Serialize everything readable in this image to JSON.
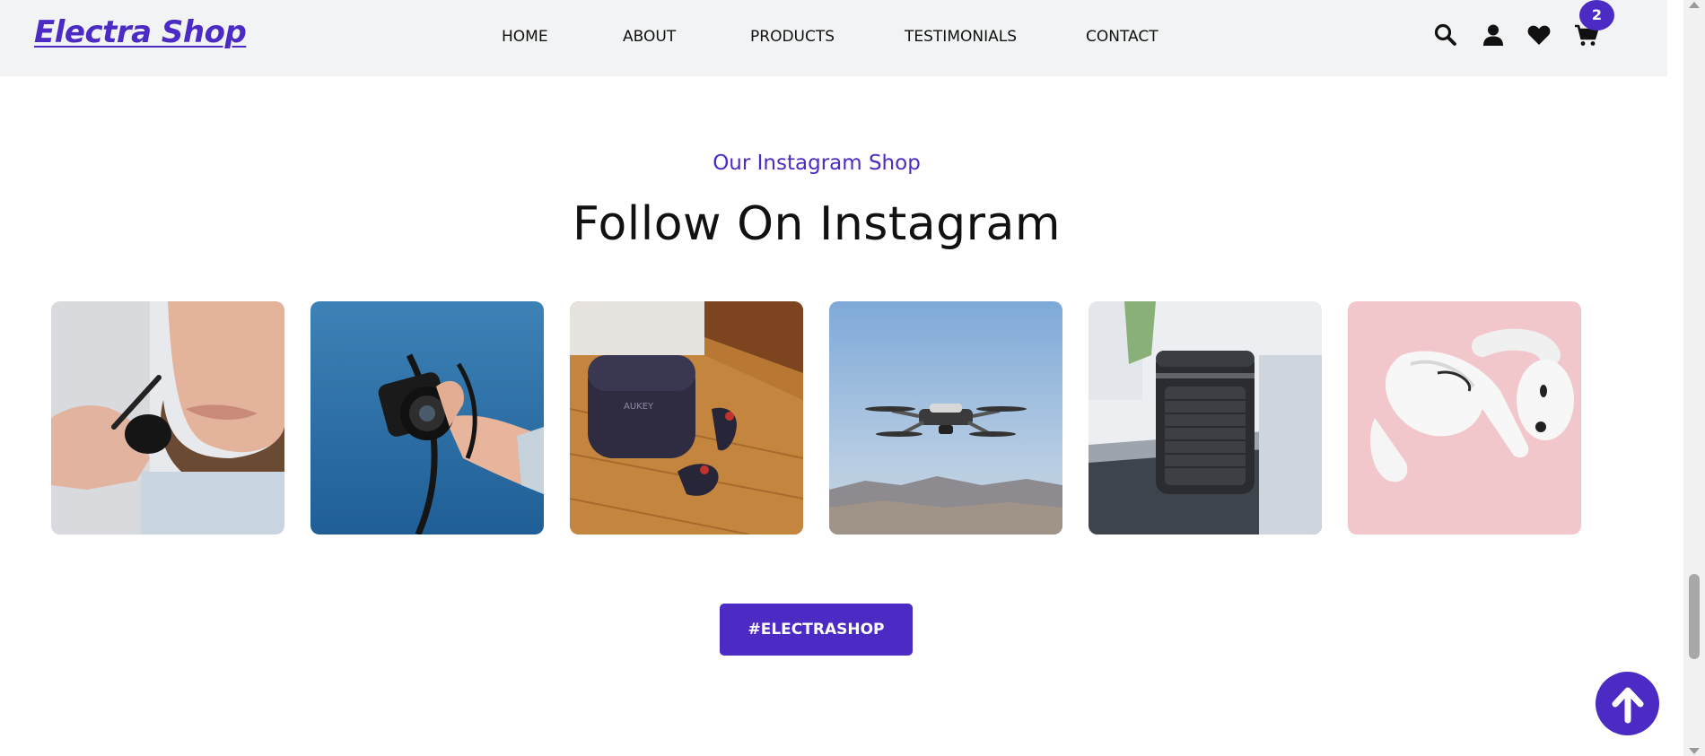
{
  "header": {
    "brand": "Electra Shop",
    "nav": [
      {
        "label": "HOME"
      },
      {
        "label": "ABOUT"
      },
      {
        "label": "PRODUCTS"
      },
      {
        "label": "TESTIMONIALS"
      },
      {
        "label": "CONTACT"
      }
    ],
    "icons": [
      "search-icon",
      "user-icon",
      "heart-icon",
      "cart-icon"
    ],
    "cart_count": "2"
  },
  "instagram": {
    "eyebrow": "Our Instagram Shop",
    "title": "Follow On Instagram",
    "photos": [
      {
        "subject": "man holding microphone headset"
      },
      {
        "subject": "hand holding camera against blue sky"
      },
      {
        "subject": "earbuds and charging case on wooden table",
        "case_text": "AUKEY"
      },
      {
        "subject": "drone flying over mountains"
      },
      {
        "subject": "bluetooth speaker"
      },
      {
        "subject": "white earbuds on pink background"
      }
    ],
    "hashtag_button": "#ELECTRASHOP"
  },
  "colors": {
    "accent": "#4b2bc4",
    "header_bg": "#f2f3f4",
    "text": "#111111"
  }
}
